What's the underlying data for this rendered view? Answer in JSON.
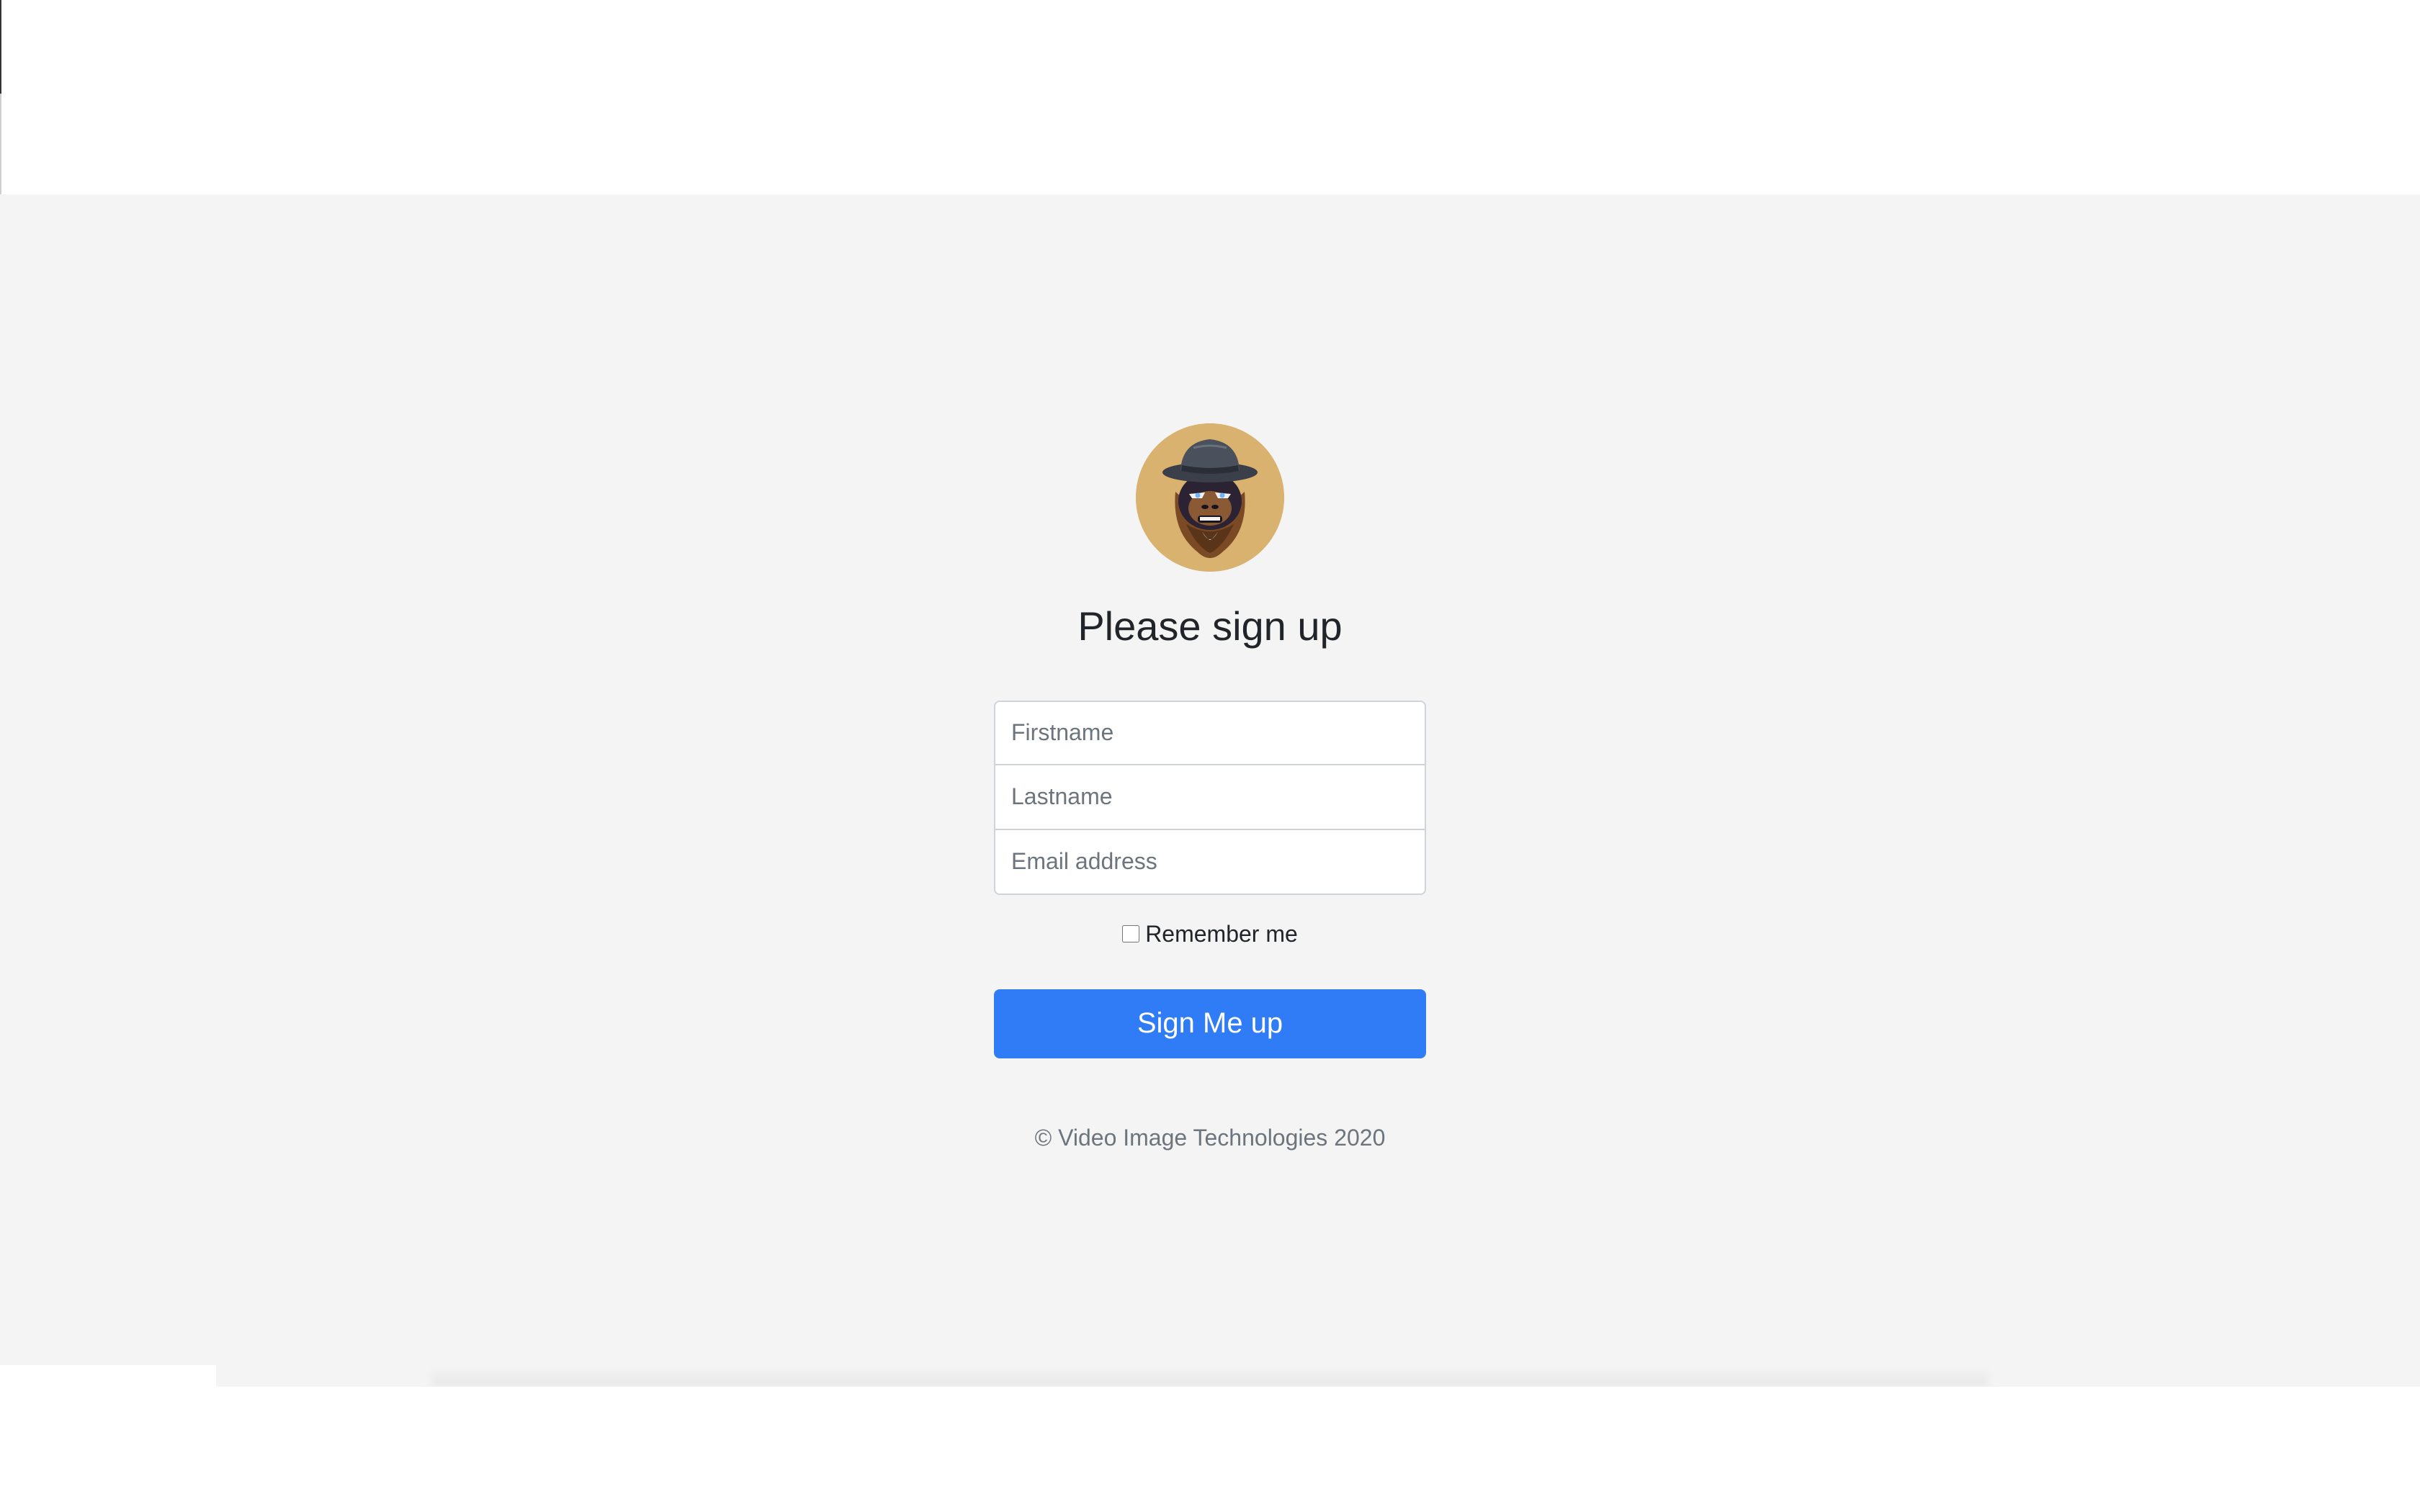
{
  "brand": {
    "logo_icon": "gorilla-with-hat-icon",
    "logo_bg_color": "#d9b26f"
  },
  "form": {
    "heading": "Please sign up",
    "firstname_placeholder": "Firstname",
    "lastname_placeholder": "Lastname",
    "email_placeholder": "Email address",
    "remember_label": "Remember me",
    "remember_checked": false,
    "submit_label": "Sign Me up",
    "accent_color": "#2f7cf6"
  },
  "footer": {
    "copyright": "© Video Image Technologies 2020"
  }
}
